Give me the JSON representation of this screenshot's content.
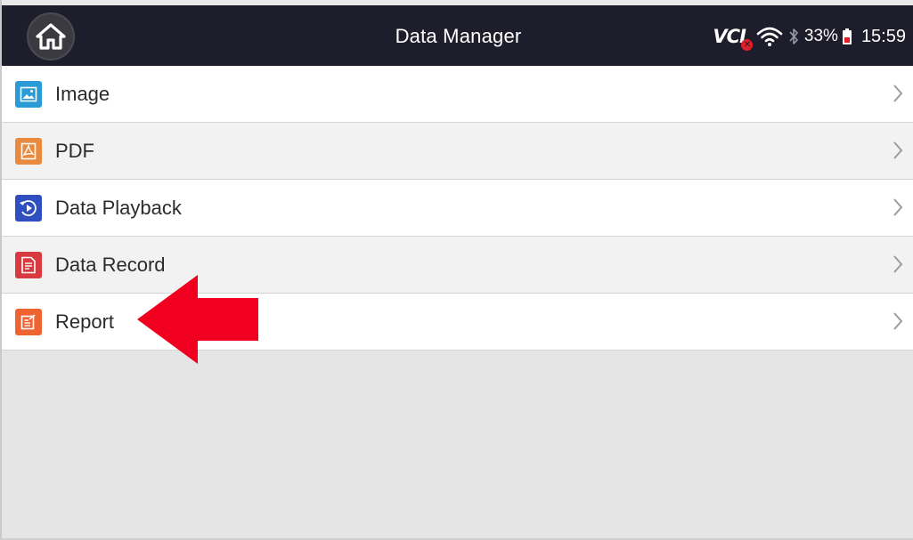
{
  "header": {
    "title": "Data Manager",
    "home_icon": "home-icon"
  },
  "status_bar": {
    "vci_label": "VCI",
    "vci_status_icon": "disconnected-x-icon",
    "wifi_icon": "wifi-icon",
    "bluetooth_icon": "bluetooth-icon",
    "battery_percent": "33%",
    "battery_icon": "battery-icon",
    "time": "15:59"
  },
  "menu": {
    "items": [
      {
        "label": "Image",
        "icon": "image-icon",
        "color": "#2a9bd6"
      },
      {
        "label": "PDF",
        "icon": "pdf-icon",
        "color": "#e98a3f"
      },
      {
        "label": "Data Playback",
        "icon": "playback-icon",
        "color": "#2f4fc0"
      },
      {
        "label": "Data Record",
        "icon": "data-record-icon",
        "color": "#d83a3f"
      },
      {
        "label": "Report",
        "icon": "report-icon",
        "color": "#ef6232"
      }
    ]
  },
  "annotation": {
    "arrow_color": "#f0001e",
    "arrow_target": "Report"
  }
}
